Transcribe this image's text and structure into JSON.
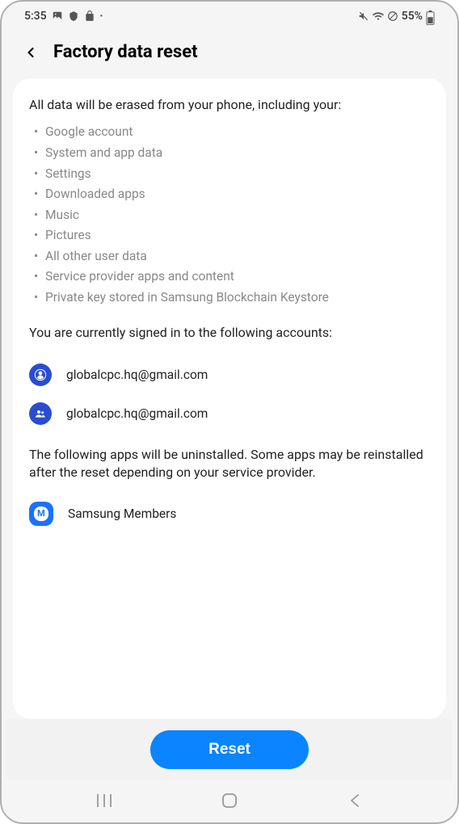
{
  "status": {
    "time": "5:35",
    "batteryPercent": "55%"
  },
  "header": {
    "title": "Factory data reset"
  },
  "content": {
    "introText": "All data will be erased from your phone, including your:",
    "bullets": [
      "Google account",
      "System and app data",
      "Settings",
      "Downloaded apps",
      "Music",
      "Pictures",
      "All other user data",
      "Service provider apps and content",
      "Private key stored in Samsung Blockchain Keystore"
    ],
    "accountsIntro": "You are currently signed in to the following accounts:",
    "accounts": [
      {
        "email": "globalcpc.hq@gmail.com"
      },
      {
        "email": "globalcpc.hq@gmail.com"
      }
    ],
    "appsIntro": "The following apps will be uninstalled. Some apps may be reinstalled after the reset depending on your service provider.",
    "apps": [
      {
        "name": "Samsung Members",
        "iconLetter": "M"
      }
    ]
  },
  "footer": {
    "resetLabel": "Reset"
  }
}
